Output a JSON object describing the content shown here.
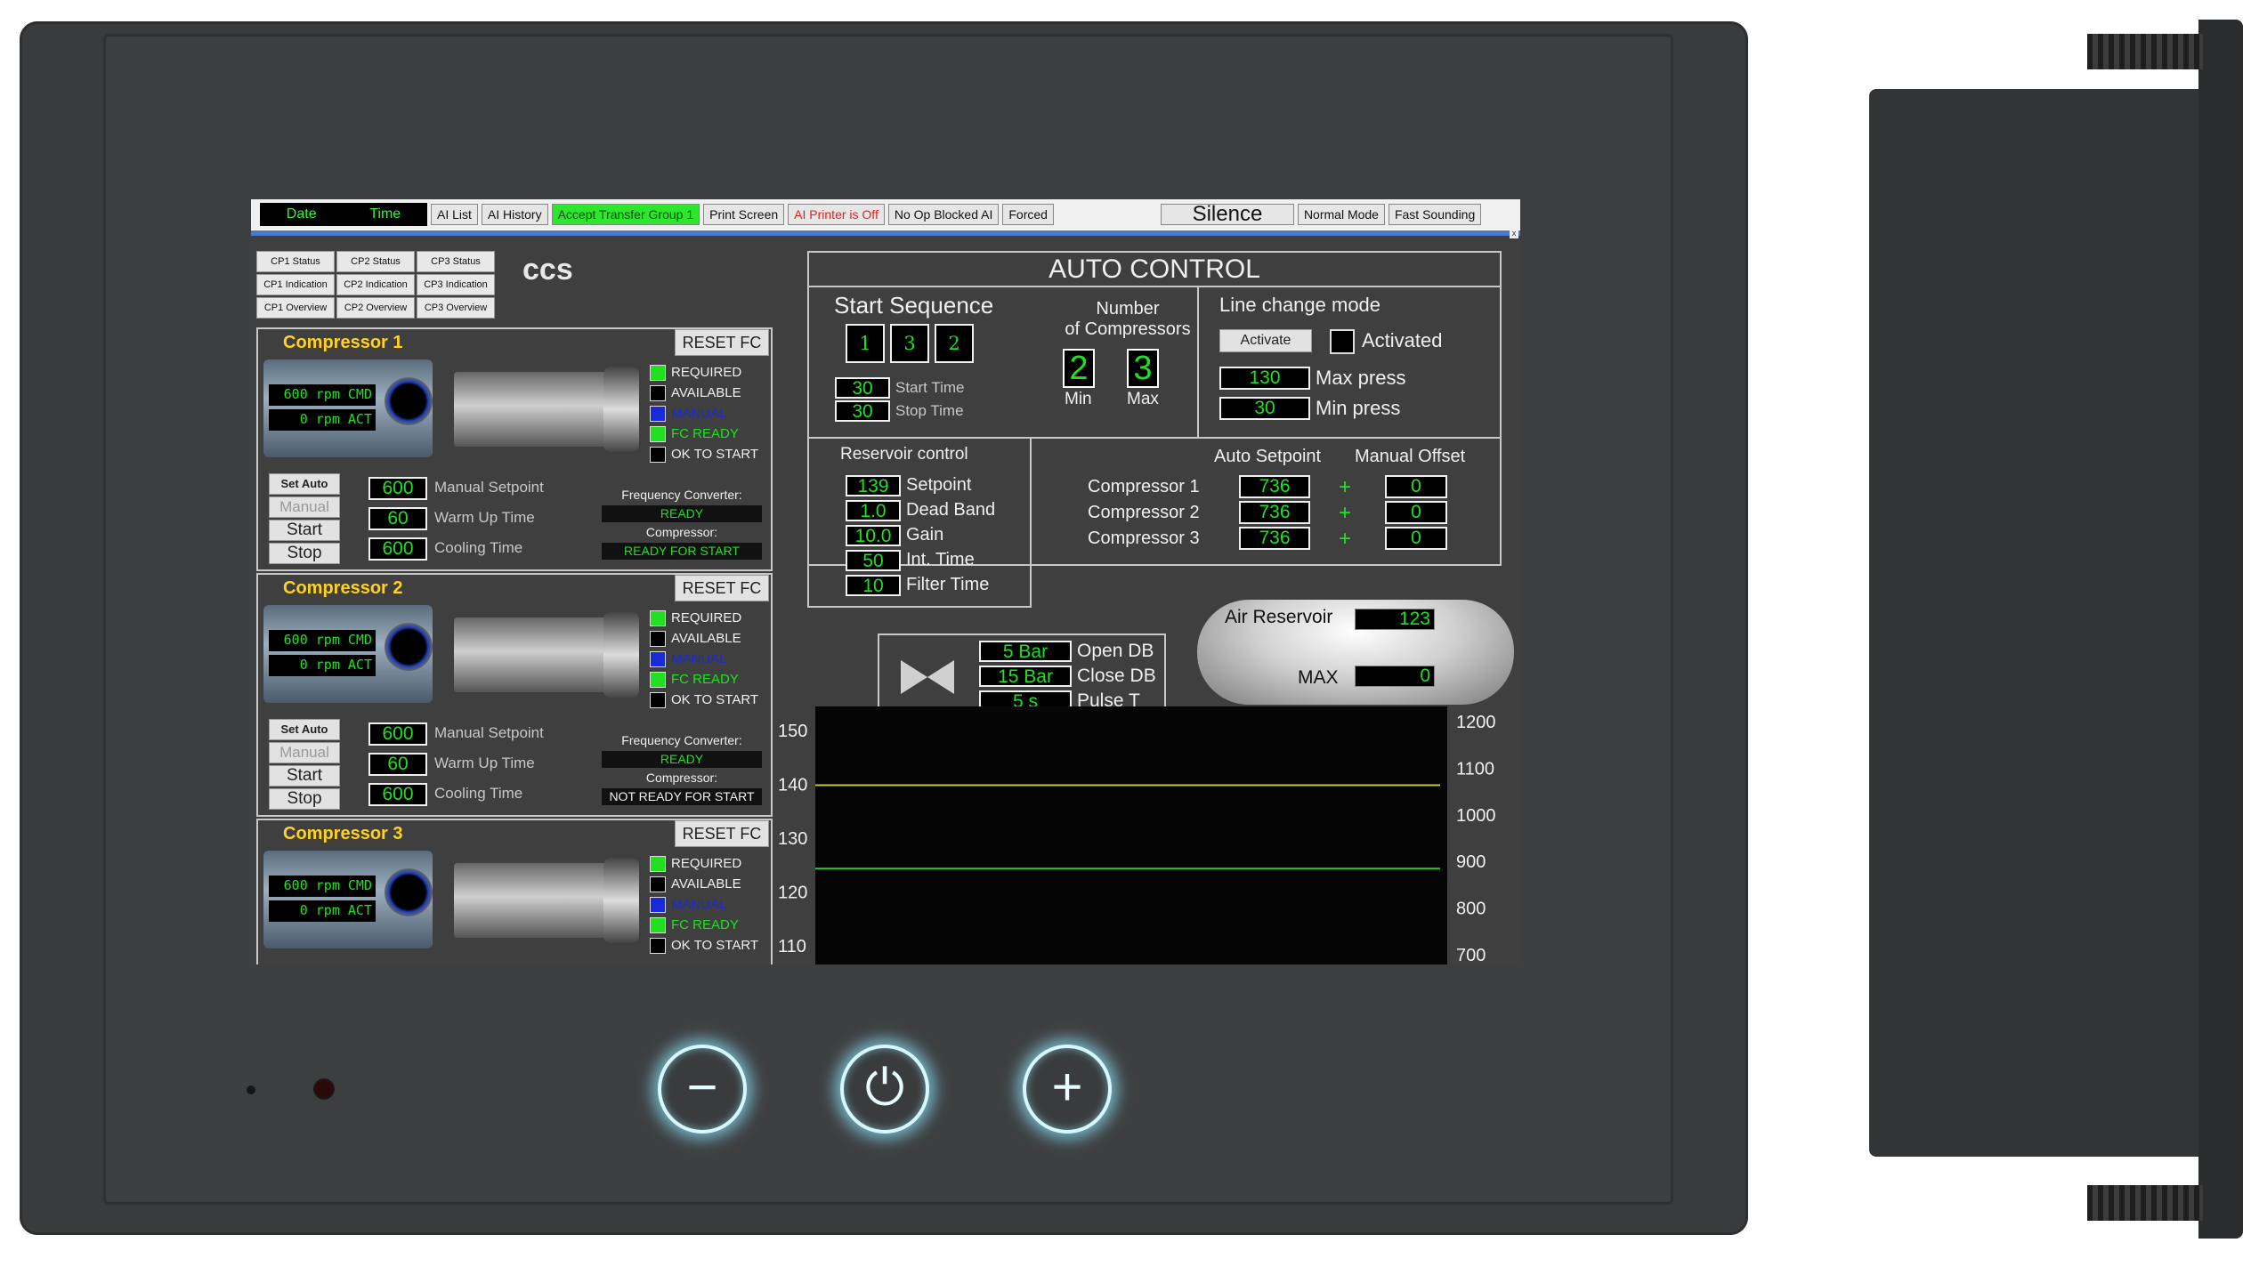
{
  "topbar": {
    "date": "Date",
    "time": "Time",
    "buttons": [
      "AI List",
      "AI History",
      "Accept Transfer Group 1",
      "Print Screen",
      "AI Printer is Off",
      "No Op Blocked AI",
      "Forced"
    ],
    "silence": "Silence",
    "normal_mode": "Normal Mode",
    "fast_sounding": "Fast Sounding",
    "close": "x"
  },
  "status_buttons": [
    "CP1 Status",
    "CP2 Status",
    "CP3 Status",
    "CP1 Indication",
    "CP2 Indication",
    "CP3 Indication",
    "CP1 Overview",
    "CP2 Overview",
    "CP3 Overview"
  ],
  "logo": "ccs",
  "compressors": [
    {
      "title": "Compressor 1",
      "reset": "RESET FC",
      "cmd": "600 rpm CMD",
      "act": "0 rpm ACT",
      "leds": [
        "REQUIRED",
        "AVAILABLE",
        "MANUAL",
        "FC READY",
        "OK TO START"
      ],
      "set_auto": "Set Auto",
      "manual": "Manual",
      "start": "Start",
      "stop": "Stop",
      "manual_setpoint": "600",
      "manual_setpoint_label": "Manual Setpoint",
      "warm_up": "60",
      "warm_up_label": "Warm Up Time",
      "cooling": "600",
      "cooling_label": "Cooling Time",
      "fc_label": "Frequency Converter:",
      "fc_state": "READY",
      "comp_label": "Compressor:",
      "comp_state": "READY FOR START"
    },
    {
      "title": "Compressor 2",
      "reset": "RESET FC",
      "cmd": "600 rpm CMD",
      "act": "0 rpm ACT",
      "leds": [
        "REQUIRED",
        "AVAILABLE",
        "MANUAL",
        "FC READY",
        "OK TO START"
      ],
      "set_auto": "Set Auto",
      "manual": "Manual",
      "start": "Start",
      "stop": "Stop",
      "manual_setpoint": "600",
      "manual_setpoint_label": "Manual Setpoint",
      "warm_up": "60",
      "warm_up_label": "Warm Up Time",
      "cooling": "600",
      "cooling_label": "Cooling Time",
      "fc_label": "Frequency Converter:",
      "fc_state": "READY",
      "comp_label": "Compressor:",
      "comp_state": "NOT READY FOR START"
    },
    {
      "title": "Compressor 3",
      "reset": "RESET FC",
      "cmd": "600 rpm CMD",
      "act": "0 rpm ACT",
      "leds": [
        "REQUIRED",
        "AVAILABLE",
        "MANUAL",
        "FC READY",
        "OK TO START"
      ]
    }
  ],
  "led_colors": [
    "#20e020",
    "#000000",
    "#1a2ad8",
    "#20e020",
    "#000000"
  ],
  "auto": {
    "title": "AUTO CONTROL",
    "start_sequence": "Start Sequence",
    "seq": [
      "1",
      "3",
      "2"
    ],
    "start_time": "30",
    "start_time_label": "Start Time",
    "stop_time": "30",
    "stop_time_label": "Stop Time",
    "number_label": "Number\nof Compressors",
    "min": "2",
    "min_label": "Min",
    "max": "3",
    "max_label": "Max",
    "line_change": "Line change mode",
    "activate": "Activate",
    "activated": "Activated",
    "max_press": "130",
    "max_press_label": "Max press",
    "min_press": "30",
    "min_press_label": "Min press"
  },
  "reservoir": {
    "title": "Reservoir control",
    "rows": [
      {
        "v": "139",
        "l": "Setpoint"
      },
      {
        "v": "1.0",
        "l": "Dead Band"
      },
      {
        "v": "10.0",
        "l": "Gain"
      },
      {
        "v": "50",
        "l": "Int. Time"
      },
      {
        "v": "10",
        "l": "Filter Time"
      }
    ]
  },
  "setpoints": {
    "auto_label": "Auto Setpoint",
    "offset_label": "Manual Offset",
    "rows": [
      {
        "name": "Compressor 1",
        "auto": "736",
        "plus": "+",
        "offset": "0"
      },
      {
        "name": "Compressor 2",
        "auto": "736",
        "plus": "+",
        "offset": "0"
      },
      {
        "name": "Compressor 3",
        "auto": "736",
        "plus": "+",
        "offset": "0"
      }
    ]
  },
  "valve": {
    "open": "5 Bar",
    "open_label": "Open DB",
    "close": "15 Bar",
    "close_label": "Close DB",
    "pulse": "5 s",
    "pulse_label": "Pulse T"
  },
  "air": {
    "label": "Air Reservoir",
    "value": "123",
    "max_label": "MAX",
    "max": "0"
  },
  "chart_data": {
    "type": "line",
    "y_left_ticks": [
      "150",
      "140",
      "130",
      "120",
      "110"
    ],
    "y_right_ticks": [
      "1200",
      "1100",
      "1000",
      "900",
      "800",
      "700"
    ],
    "ylim_left": [
      110,
      150
    ],
    "ylim_right": [
      700,
      1200
    ],
    "series": [
      {
        "axis": "left",
        "color": "#c8c83a",
        "values": [
          140,
          140
        ]
      },
      {
        "axis": "left",
        "color": "#2ec82e",
        "values": [
          124.5,
          124.5
        ]
      }
    ]
  },
  "hardware": {
    "minus": "−",
    "power": "⏻",
    "plus": "+"
  }
}
